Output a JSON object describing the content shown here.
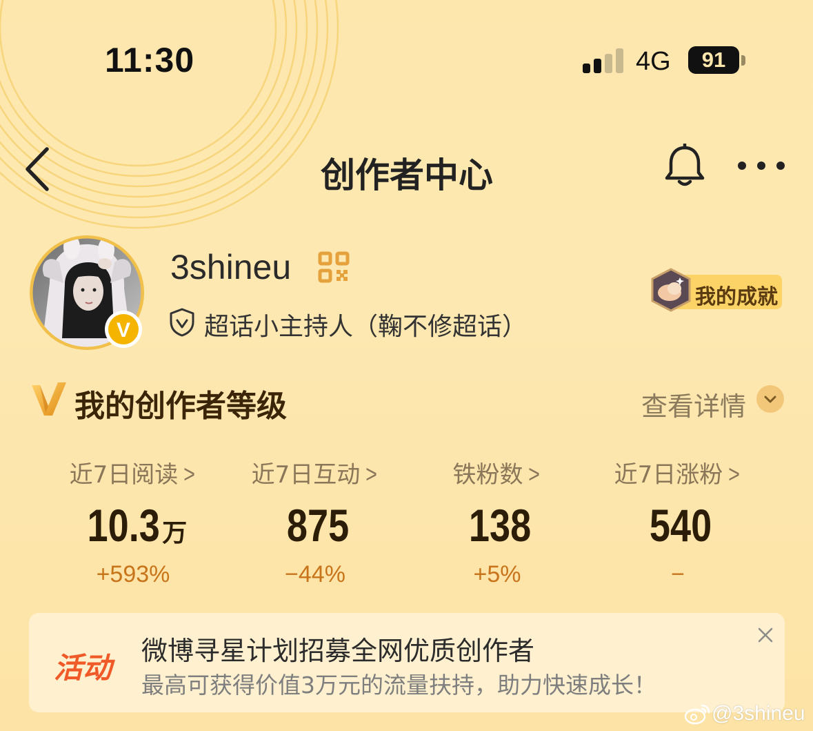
{
  "status_bar": {
    "time": "11:30",
    "network": "4G",
    "battery": "91",
    "signal_bars_active": 2
  },
  "nav": {
    "title": "创作者中心",
    "back_icon": "chevron-left-icon",
    "bell_icon": "bell-icon",
    "more_icon": "more-dots-icon"
  },
  "profile": {
    "username": "3shineu",
    "role": "超话小主持人（鞠不修超话）",
    "verified_badge": "V",
    "achievements_label": "我的成就"
  },
  "creator_level": {
    "title": "我的创作者等级",
    "details_label": "查看详情"
  },
  "stats": [
    {
      "label": "近7日阅读",
      "value": "10.3",
      "unit": "万",
      "change": "+593%"
    },
    {
      "label": "近7日互动",
      "value": "875",
      "unit": "",
      "change": "−44%"
    },
    {
      "label": "铁粉数",
      "value": "138",
      "unit": "",
      "change": "+5%"
    },
    {
      "label": "近7日涨粉",
      "value": "540",
      "unit": "",
      "change": "−"
    }
  ],
  "activity": {
    "tag": "活动",
    "title": "微博寻星计划招募全网优质创作者",
    "description": "最高可获得价值3万元的流量扶持，助力快速成长！"
  },
  "watermark": {
    "text": "@3shineu"
  },
  "colors": {
    "background": "#fde7ad",
    "accent_orange": "#c8741a",
    "activity_red": "#f05a28",
    "text_dark": "#2c1d08",
    "label_brown": "#8a7658"
  }
}
